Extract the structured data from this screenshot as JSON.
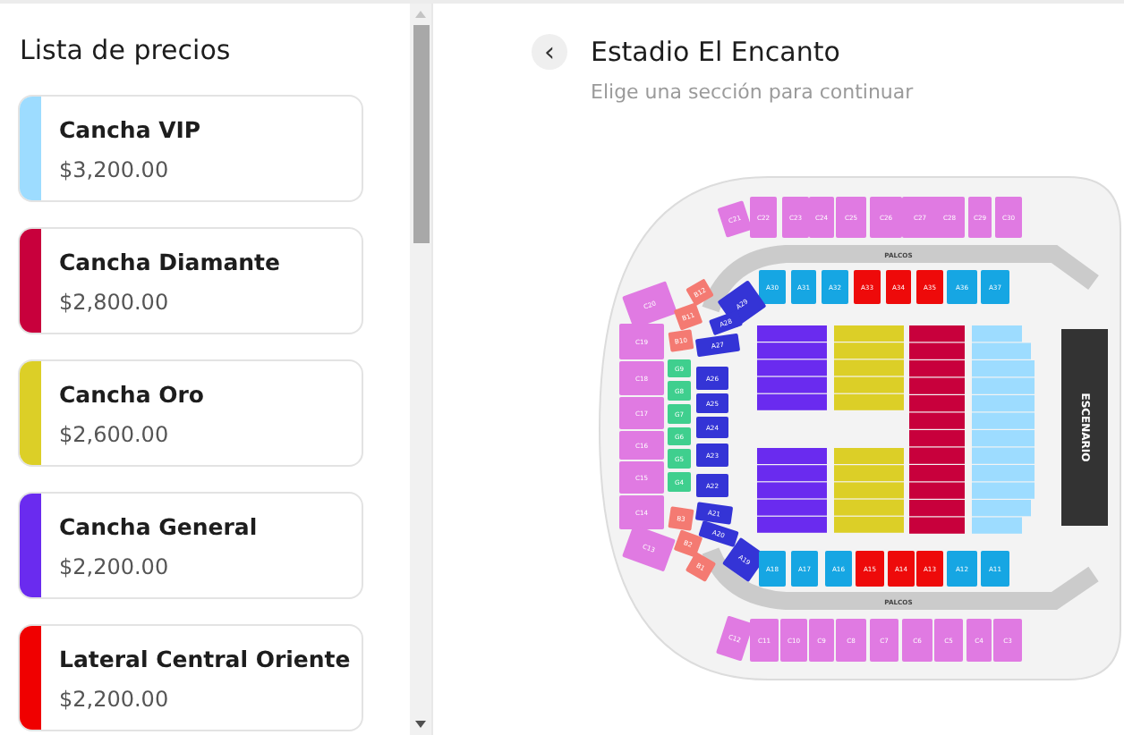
{
  "price_list": {
    "title": "Lista de precios",
    "items": [
      {
        "name": "Cancha VIP",
        "price": "$3,200.00",
        "color": "#9ddcff"
      },
      {
        "name": "Cancha Diamante",
        "price": "$2,800.00",
        "color": "#c8003c"
      },
      {
        "name": "Cancha Oro",
        "price": "$2,600.00",
        "color": "#dccf27"
      },
      {
        "name": "Cancha General",
        "price": "$2,200.00",
        "color": "#6a2bef"
      },
      {
        "name": "Lateral Central Oriente",
        "price": "$2,200.00",
        "color": "#f00000"
      }
    ]
  },
  "venue": {
    "back_label": "‹",
    "title": "Estadio El Encanto",
    "subtitle": "Elige una sección para continuar"
  },
  "map": {
    "stage_label": "ESCENARIO",
    "palcos": [
      "PALCOS",
      "PALCOS"
    ],
    "field": [
      {
        "kind": "split",
        "color": "#6a2bef"
      },
      {
        "kind": "split",
        "color": "#dccf27"
      },
      {
        "kind": "full",
        "color": "#c8003c"
      },
      {
        "kind": "stepped",
        "color": "#9ddcff"
      }
    ],
    "sections": [
      {
        "label": "C21",
        "color": "#e07ae2"
      },
      {
        "label": "C22",
        "color": "#e07ae2"
      },
      {
        "label": "C23",
        "color": "#e07ae2"
      },
      {
        "label": "C24",
        "color": "#e07ae2"
      },
      {
        "label": "C25",
        "color": "#e07ae2"
      },
      {
        "label": "C26",
        "color": "#e07ae2"
      },
      {
        "label": "C27",
        "color": "#e07ae2"
      },
      {
        "label": "C28",
        "color": "#e07ae2"
      },
      {
        "label": "C29",
        "color": "#e07ae2"
      },
      {
        "label": "C30",
        "color": "#e07ae2"
      },
      {
        "label": "A30",
        "color": "#16a6e3"
      },
      {
        "label": "A31",
        "color": "#16a6e3"
      },
      {
        "label": "A32",
        "color": "#16a6e3"
      },
      {
        "label": "A33",
        "color": "#ee0a0a"
      },
      {
        "label": "A34",
        "color": "#ee0a0a"
      },
      {
        "label": "A35",
        "color": "#ee0a0a"
      },
      {
        "label": "A36",
        "color": "#16a6e3"
      },
      {
        "label": "A37",
        "color": "#16a6e3"
      },
      {
        "label": "C20",
        "color": "#e07ae2"
      },
      {
        "label": "C19",
        "color": "#e07ae2"
      },
      {
        "label": "C18",
        "color": "#e07ae2"
      },
      {
        "label": "C17",
        "color": "#e07ae2"
      },
      {
        "label": "C16",
        "color": "#e07ae2"
      },
      {
        "label": "C15",
        "color": "#e07ae2"
      },
      {
        "label": "C14",
        "color": "#e07ae2"
      },
      {
        "label": "C13",
        "color": "#e07ae2"
      },
      {
        "label": "B12",
        "color": "#f47a72"
      },
      {
        "label": "B11",
        "color": "#f47a72"
      },
      {
        "label": "B10",
        "color": "#f47a72"
      },
      {
        "label": "G9",
        "color": "#3fcf8e"
      },
      {
        "label": "G8",
        "color": "#3fcf8e"
      },
      {
        "label": "G7",
        "color": "#3fcf8e"
      },
      {
        "label": "G6",
        "color": "#3fcf8e"
      },
      {
        "label": "G5",
        "color": "#3fcf8e"
      },
      {
        "label": "G4",
        "color": "#3fcf8e"
      },
      {
        "label": "B3",
        "color": "#f47a72"
      },
      {
        "label": "B2",
        "color": "#f47a72"
      },
      {
        "label": "B1",
        "color": "#f47a72"
      },
      {
        "label": "A29",
        "color": "#3434d6"
      },
      {
        "label": "A28",
        "color": "#3434d6"
      },
      {
        "label": "A27",
        "color": "#3434d6"
      },
      {
        "label": "A26",
        "color": "#3434d6"
      },
      {
        "label": "A25",
        "color": "#3434d6"
      },
      {
        "label": "A24",
        "color": "#3434d6"
      },
      {
        "label": "A23",
        "color": "#3434d6"
      },
      {
        "label": "A22",
        "color": "#3434d6"
      },
      {
        "label": "A21",
        "color": "#3434d6"
      },
      {
        "label": "A20",
        "color": "#3434d6"
      },
      {
        "label": "A19",
        "color": "#3434d6"
      },
      {
        "label": "A18",
        "color": "#16a6e3"
      },
      {
        "label": "A17",
        "color": "#16a6e3"
      },
      {
        "label": "A16",
        "color": "#16a6e3"
      },
      {
        "label": "A15",
        "color": "#ee0a0a"
      },
      {
        "label": "A14",
        "color": "#ee0a0a"
      },
      {
        "label": "A13",
        "color": "#ee0a0a"
      },
      {
        "label": "A12",
        "color": "#16a6e3"
      },
      {
        "label": "A11",
        "color": "#16a6e3"
      },
      {
        "label": "C12",
        "color": "#e07ae2"
      },
      {
        "label": "C11",
        "color": "#e07ae2"
      },
      {
        "label": "C10",
        "color": "#e07ae2"
      },
      {
        "label": "C9",
        "color": "#e07ae2"
      },
      {
        "label": "C8",
        "color": "#e07ae2"
      },
      {
        "label": "C7",
        "color": "#e07ae2"
      },
      {
        "label": "C6",
        "color": "#e07ae2"
      },
      {
        "label": "C5",
        "color": "#e07ae2"
      },
      {
        "label": "C4",
        "color": "#e07ae2"
      },
      {
        "label": "C3",
        "color": "#e07ae2"
      }
    ]
  }
}
